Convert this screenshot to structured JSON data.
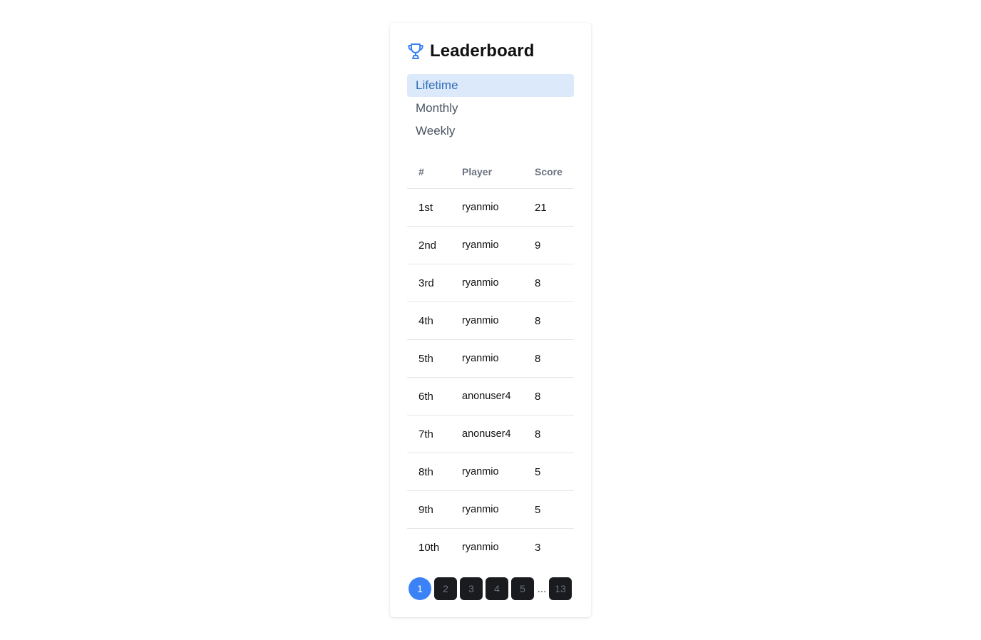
{
  "header": {
    "title": "Leaderboard",
    "icon": "trophy-icon",
    "accent_color": "#3b82f6"
  },
  "tabs": [
    {
      "label": "Lifetime",
      "active": true
    },
    {
      "label": "Monthly",
      "active": false
    },
    {
      "label": "Weekly",
      "active": false
    }
  ],
  "table": {
    "columns": [
      "#",
      "Player",
      "Score"
    ],
    "rows": [
      {
        "rank": "1st",
        "player": "ryanmio",
        "score": "21"
      },
      {
        "rank": "2nd",
        "player": "ryanmio",
        "score": "9"
      },
      {
        "rank": "3rd",
        "player": "ryanmio",
        "score": "8"
      },
      {
        "rank": "4th",
        "player": "ryanmio",
        "score": "8"
      },
      {
        "rank": "5th",
        "player": "ryanmio",
        "score": "8"
      },
      {
        "rank": "6th",
        "player": "anonuser4",
        "score": "8"
      },
      {
        "rank": "7th",
        "player": "anonuser4",
        "score": "8"
      },
      {
        "rank": "8th",
        "player": "ryanmio",
        "score": "5"
      },
      {
        "rank": "9th",
        "player": "ryanmio",
        "score": "5"
      },
      {
        "rank": "10th",
        "player": "ryanmio",
        "score": "3"
      }
    ]
  },
  "pagination": {
    "pages": [
      "1",
      "2",
      "3",
      "4",
      "5"
    ],
    "ellipsis": "...",
    "last_page": "13",
    "current": "1"
  }
}
